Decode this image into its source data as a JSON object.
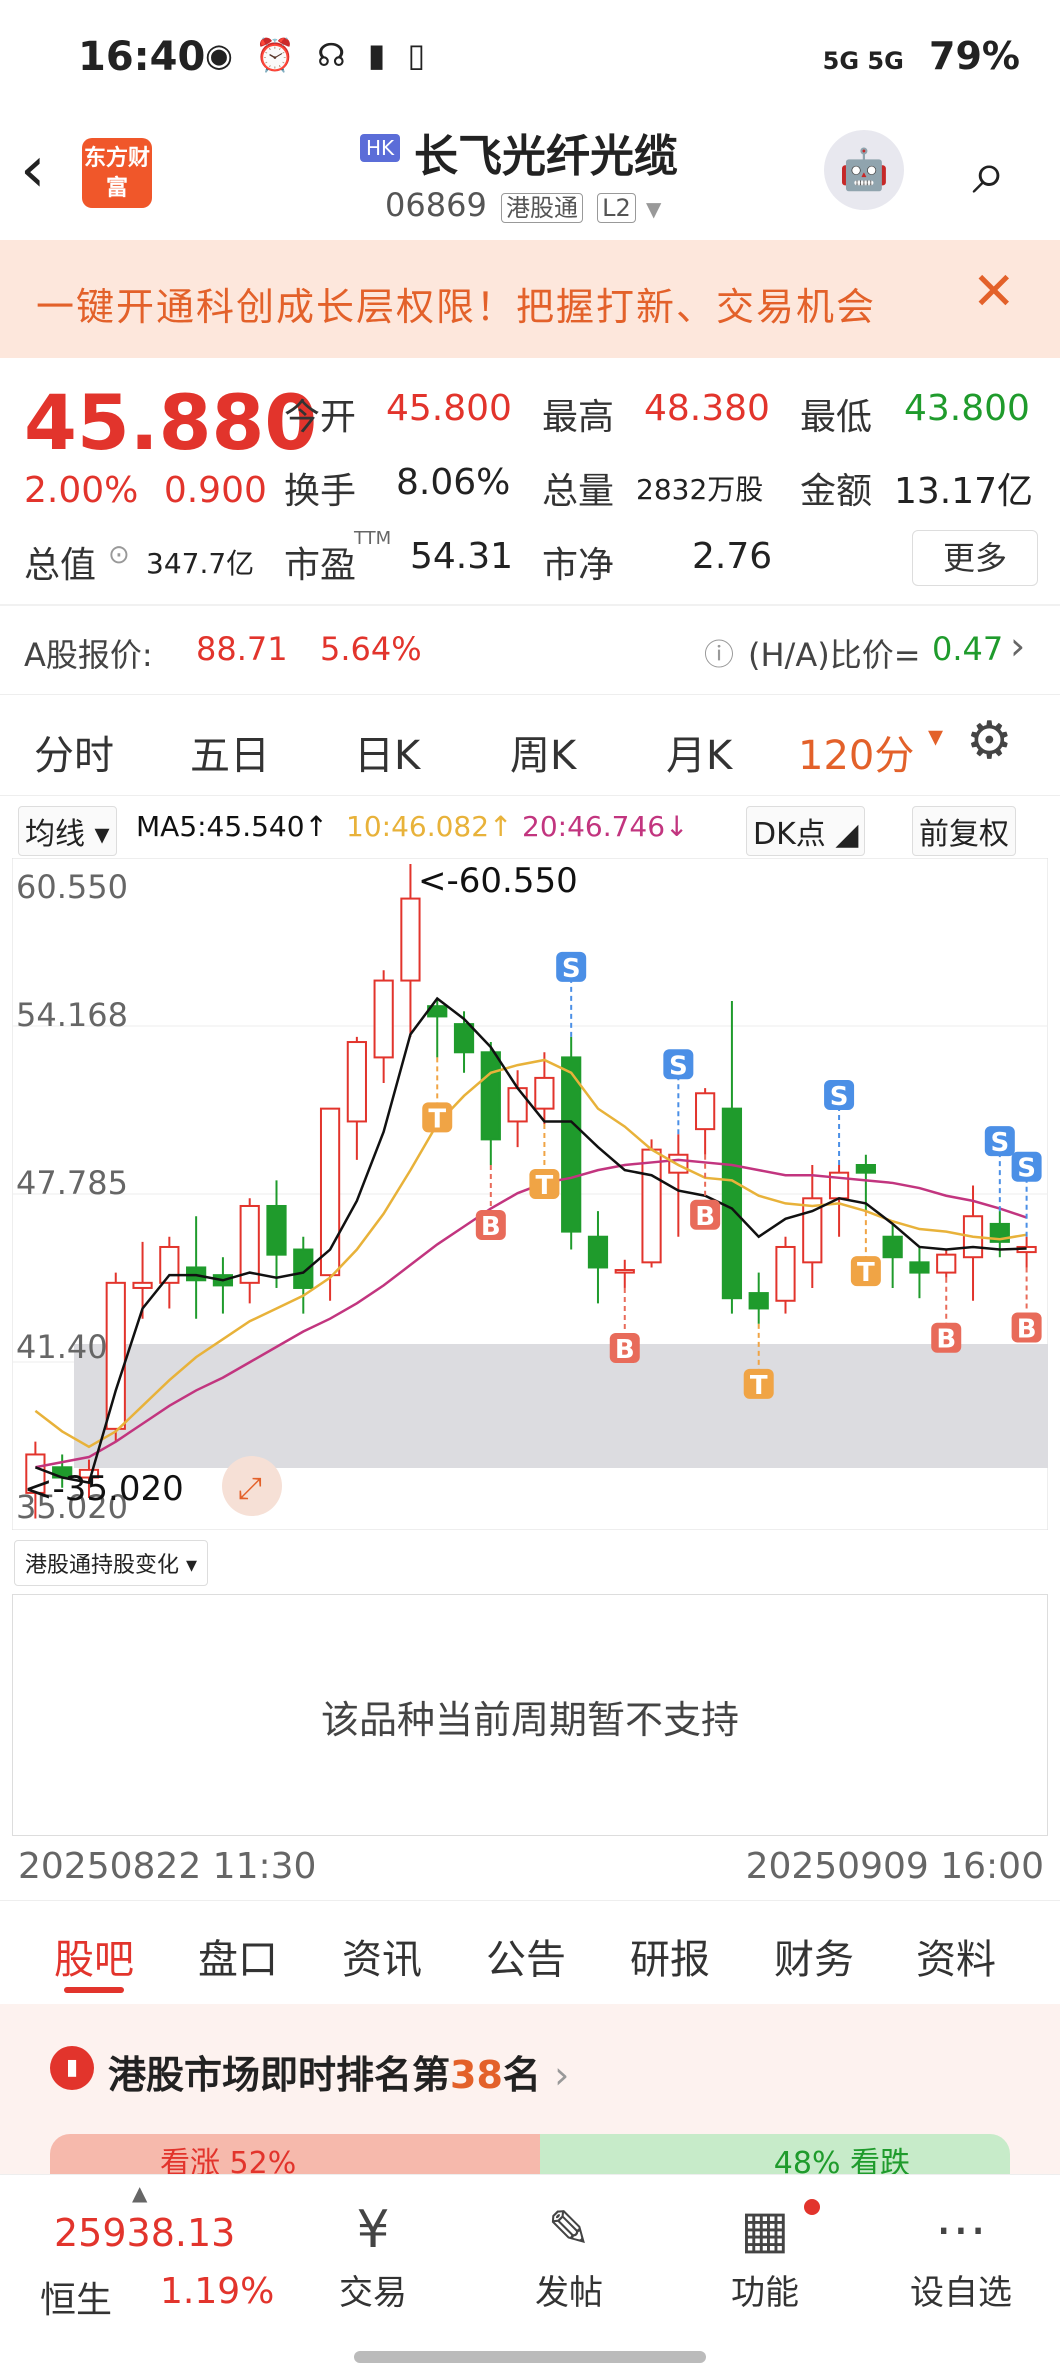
{
  "status": {
    "time": "16:40",
    "icons": "◉ ⏰ ☊ ▮ ▯",
    "network": "5G 5G",
    "battery": "79%"
  },
  "header": {
    "back": "‹",
    "logo": "东方财富",
    "market_tag": "HK",
    "name": "长飞光纤光缆",
    "code": "06869",
    "channel": "港股通",
    "level": "L2",
    "robot": "🤖",
    "search": "⌕"
  },
  "promo": {
    "text": "一键开通科创成长层权限！把握打新、交易机会",
    "close": "✕"
  },
  "quote": {
    "price": "45.880",
    "change_pct": "2.00%",
    "change_abs": "0.900",
    "open_label": "今开",
    "open": "45.800",
    "high_label": "最高",
    "high": "48.380",
    "low_label": "最低",
    "low": "43.800",
    "turnover_label": "换手",
    "turnover": "8.06%",
    "volume_label": "总量",
    "volume": "2832万股",
    "amount_label": "金额",
    "amount": "13.17亿",
    "mktcap_label": "总值",
    "mktcap": "347.7亿",
    "pe_label": "市盈",
    "pe_sup": "TTM",
    "pe": "54.31",
    "pb_label": "市净",
    "pb": "2.76",
    "more": "更多"
  },
  "ashare": {
    "label": "A股报价:",
    "price": "88.71",
    "pct": "5.64%",
    "ha_label": "(H/A)比价=",
    "ha_value": "0.47",
    "arrow": "›"
  },
  "ktabs": [
    "分时",
    "五日",
    "日K",
    "周K",
    "月K",
    "120分"
  ],
  "ma_row": {
    "ma_btn": "均线",
    "ma5": "MA5:45.540↑",
    "ma10": "10:46.082↑",
    "ma20": "20:46.746↓",
    "dk": "DK点",
    "adj": "前复权"
  },
  "chart_labels": {
    "y1": "60.550",
    "y2": "54.168",
    "y3": "47.785",
    "y4": "41.403",
    "y5": "35.020",
    "max_note": "<-60.550",
    "min_note": "<-35.020"
  },
  "chart_data": {
    "type": "candlestick",
    "ylim": [
      35.02,
      60.55
    ],
    "colors": {
      "up": "#e2342c",
      "down": "#1f9b2c",
      "ma5": "#111111",
      "ma10": "#e8b23a",
      "ma20": "#c2357f"
    },
    "candles": [
      [
        36.0,
        38.0,
        35.0,
        37.5
      ],
      [
        37.0,
        37.5,
        36.2,
        36.6
      ],
      [
        36.6,
        37.3,
        35.8,
        36.9
      ],
      [
        38.5,
        44.6,
        38.0,
        44.2
      ],
      [
        44.0,
        45.8,
        42.8,
        44.2
      ],
      [
        44.2,
        46.0,
        43.2,
        45.6
      ],
      [
        44.8,
        46.8,
        42.8,
        44.3
      ],
      [
        44.5,
        45.2,
        43.0,
        44.1
      ],
      [
        44.2,
        47.5,
        43.4,
        47.2
      ],
      [
        47.2,
        48.2,
        44.0,
        45.3
      ],
      [
        45.5,
        46.0,
        43.0,
        44.0
      ],
      [
        44.5,
        51.0,
        43.5,
        51.0
      ],
      [
        50.5,
        53.8,
        49.0,
        53.6
      ],
      [
        53.0,
        56.4,
        52.0,
        56.0
      ],
      [
        56.0,
        60.55,
        53.8,
        59.2
      ],
      [
        55.0,
        55.3,
        53.0,
        54.6
      ],
      [
        54.3,
        54.8,
        52.4,
        53.2
      ],
      [
        53.2,
        53.6,
        48.8,
        49.8
      ],
      [
        50.5,
        52.5,
        49.5,
        51.8
      ],
      [
        51.0,
        53.2,
        50.4,
        52.2
      ],
      [
        53.0,
        53.8,
        45.5,
        46.2
      ],
      [
        46.0,
        47.0,
        43.4,
        44.8
      ],
      [
        44.6,
        45.1,
        44.0,
        44.7
      ],
      [
        45.0,
        49.8,
        44.8,
        49.4
      ],
      [
        48.5,
        50.0,
        46.0,
        49.2
      ],
      [
        50.2,
        51.8,
        49.2,
        51.6
      ],
      [
        51.0,
        55.2,
        43.0,
        43.6
      ],
      [
        43.8,
        44.6,
        42.6,
        43.2
      ],
      [
        43.5,
        46.0,
        43.0,
        45.6
      ],
      [
        45.0,
        48.8,
        44.0,
        47.5
      ],
      [
        47.5,
        48.8,
        46.0,
        48.5
      ],
      [
        48.8,
        49.2,
        47.0,
        48.5
      ],
      [
        46.0,
        46.5,
        44.0,
        45.2
      ],
      [
        45.0,
        45.6,
        43.6,
        44.6
      ],
      [
        44.6,
        45.5,
        44.4,
        45.3
      ],
      [
        45.2,
        48.0,
        43.5,
        46.8
      ],
      [
        46.5,
        47.0,
        45.2,
        45.8
      ],
      [
        45.4,
        46.0,
        44.8,
        45.6
      ]
    ],
    "ma5": [
      37.0,
      36.6,
      36.4,
      40.0,
      43.2,
      44.5,
      44.5,
      44.3,
      44.6,
      44.4,
      44.6,
      45.5,
      47.4,
      50.1,
      53.9,
      55.3,
      54.5,
      53.4,
      51.8,
      50.5,
      50.5,
      49.5,
      48.6,
      48.4,
      47.8,
      47.6,
      47.1,
      46.0,
      46.7,
      47.0,
      47.5,
      47.3,
      46.5,
      45.6,
      45.5,
      45.6,
      45.5,
      45.54
    ],
    "ma10": [
      39.2,
      38.4,
      37.8,
      38.4,
      39.4,
      40.4,
      41.3,
      42.0,
      42.7,
      43.2,
      43.7,
      44.4,
      45.5,
      46.9,
      48.6,
      50.4,
      51.5,
      52.4,
      52.7,
      52.9,
      52.4,
      51.0,
      50.3,
      49.4,
      48.8,
      48.3,
      48.2,
      47.6,
      47.3,
      47.2,
      47.3,
      47.0,
      46.6,
      46.3,
      46.2,
      46.0,
      45.9,
      46.08
    ],
    "ma20": [
      37.0,
      37.2,
      37.4,
      38.0,
      38.7,
      39.4,
      40.0,
      40.5,
      41.1,
      41.7,
      42.3,
      42.8,
      43.4,
      44.1,
      44.9,
      45.7,
      46.4,
      47.1,
      47.7,
      48.1,
      48.3,
      48.6,
      48.8,
      48.9,
      49.0,
      48.9,
      48.8,
      48.6,
      48.4,
      48.4,
      48.3,
      48.2,
      48.1,
      47.9,
      47.6,
      47.4,
      47.1,
      46.75
    ],
    "signals": [
      {
        "i": 15,
        "t": "T"
      },
      {
        "i": 17,
        "t": "B"
      },
      {
        "i": 19,
        "t": "T"
      },
      {
        "i": 20,
        "t": "S"
      },
      {
        "i": 22,
        "t": "B"
      },
      {
        "i": 24,
        "t": "S"
      },
      {
        "i": 25,
        "t": "B"
      },
      {
        "i": 27,
        "t": "T"
      },
      {
        "i": 30,
        "t": "S"
      },
      {
        "i": 31,
        "t": "T"
      },
      {
        "i": 34,
        "t": "B"
      },
      {
        "i": 36,
        "t": "S"
      },
      {
        "i": 37,
        "t": "B"
      },
      {
        "i": 38,
        "t": "S"
      }
    ]
  },
  "holdings": {
    "select": "港股通持股变化 ▾",
    "message": "该品种当前周期暂不支持"
  },
  "dates": {
    "start": "20250822 11:30",
    "end": "20250909 16:00"
  },
  "btabs": [
    "股吧",
    "盘口",
    "资讯",
    "公告",
    "研报",
    "财务",
    "资料"
  ],
  "rank": {
    "title_pre": "港股市场即时排名第",
    "rank": "38",
    "title_post": "名",
    "up": "看涨 52%",
    "down": "48% 看跌"
  },
  "nav": {
    "index_value": "25938.13",
    "index_name": "恒生",
    "index_pct": "1.19%",
    "items": [
      {
        "icon": "¥",
        "label": "交易"
      },
      {
        "icon": "✎",
        "label": "发帖"
      },
      {
        "icon": "▦",
        "label": "功能"
      },
      {
        "icon": "⋯",
        "label": "设自选"
      }
    ]
  }
}
